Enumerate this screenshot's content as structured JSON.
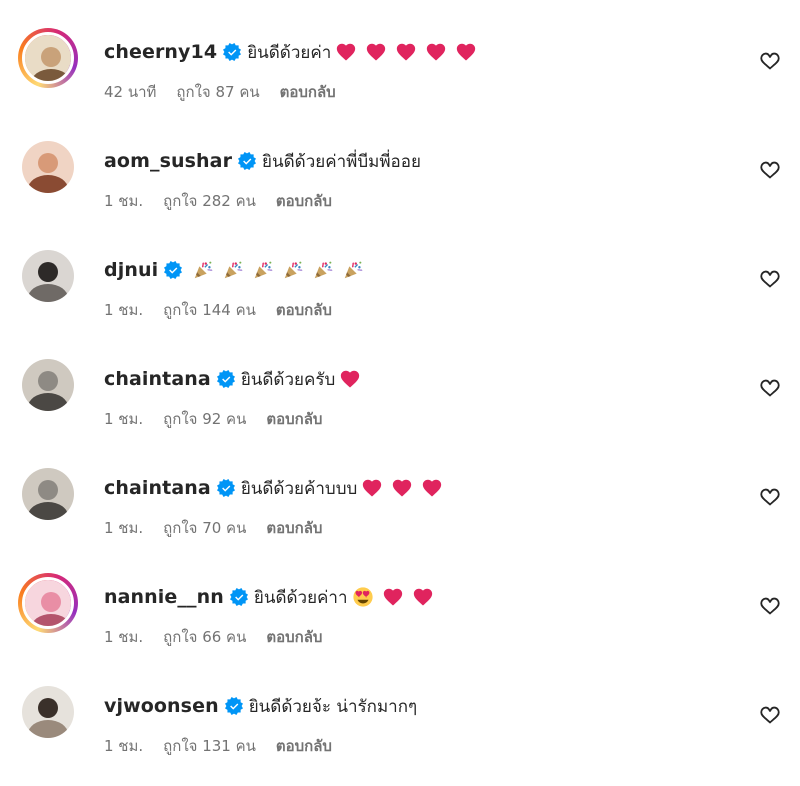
{
  "comments": [
    {
      "username": "cheerny14",
      "text": "ยินดีด้วยค่า",
      "emojis": [
        "red-heart",
        "red-heart",
        "red-heart",
        "red-heart",
        "red-heart"
      ],
      "time": "42 นาที",
      "likes": "ถูกใจ 87 คน",
      "reply": "ตอบกลับ",
      "story_ring": true
    },
    {
      "username": "aom_sushar",
      "text": "ยินดีด้วยค่าพี่บีมพี่ออย",
      "emojis": [],
      "time": "1 ชม.",
      "likes": "ถูกใจ 282 คน",
      "reply": "ตอบกลับ",
      "story_ring": false
    },
    {
      "username": "djnui",
      "text": "",
      "emojis": [
        "party-popper",
        "party-popper",
        "party-popper",
        "party-popper",
        "party-popper",
        "party-popper"
      ],
      "time": "1 ชม.",
      "likes": "ถูกใจ 144 คน",
      "reply": "ตอบกลับ",
      "story_ring": false
    },
    {
      "username": "chaintana",
      "text": "ยินดีด้วยครับ",
      "emojis": [
        "red-heart"
      ],
      "time": "1 ชม.",
      "likes": "ถูกใจ 92 คน",
      "reply": "ตอบกลับ",
      "story_ring": false
    },
    {
      "username": "chaintana",
      "text": "ยินดีด้วยค้าบบบ",
      "emojis": [
        "red-heart",
        "red-heart",
        "red-heart"
      ],
      "time": "1 ชม.",
      "likes": "ถูกใจ 70 คน",
      "reply": "ตอบกลับ",
      "story_ring": false
    },
    {
      "username": "nannie__nn",
      "text": "ยินดีด้วยค่าา",
      "emojis": [
        "heart-eyes",
        "red-heart",
        "red-heart"
      ],
      "time": "1 ชม.",
      "likes": "ถูกใจ 66 คน",
      "reply": "ตอบกลับ",
      "story_ring": true
    },
    {
      "username": "vjwoonsen",
      "text": "ยินดีด้วยจ้ะ น่ารักมากๆ",
      "emojis": [],
      "time": "1 ชม.",
      "likes": "ถูกใจ 131 คน",
      "reply": "ตอบกลับ",
      "story_ring": false
    }
  ],
  "colors": {
    "verified": "#0095f6",
    "heart_emoji": "#e0245e",
    "meta_text": "#737373"
  }
}
